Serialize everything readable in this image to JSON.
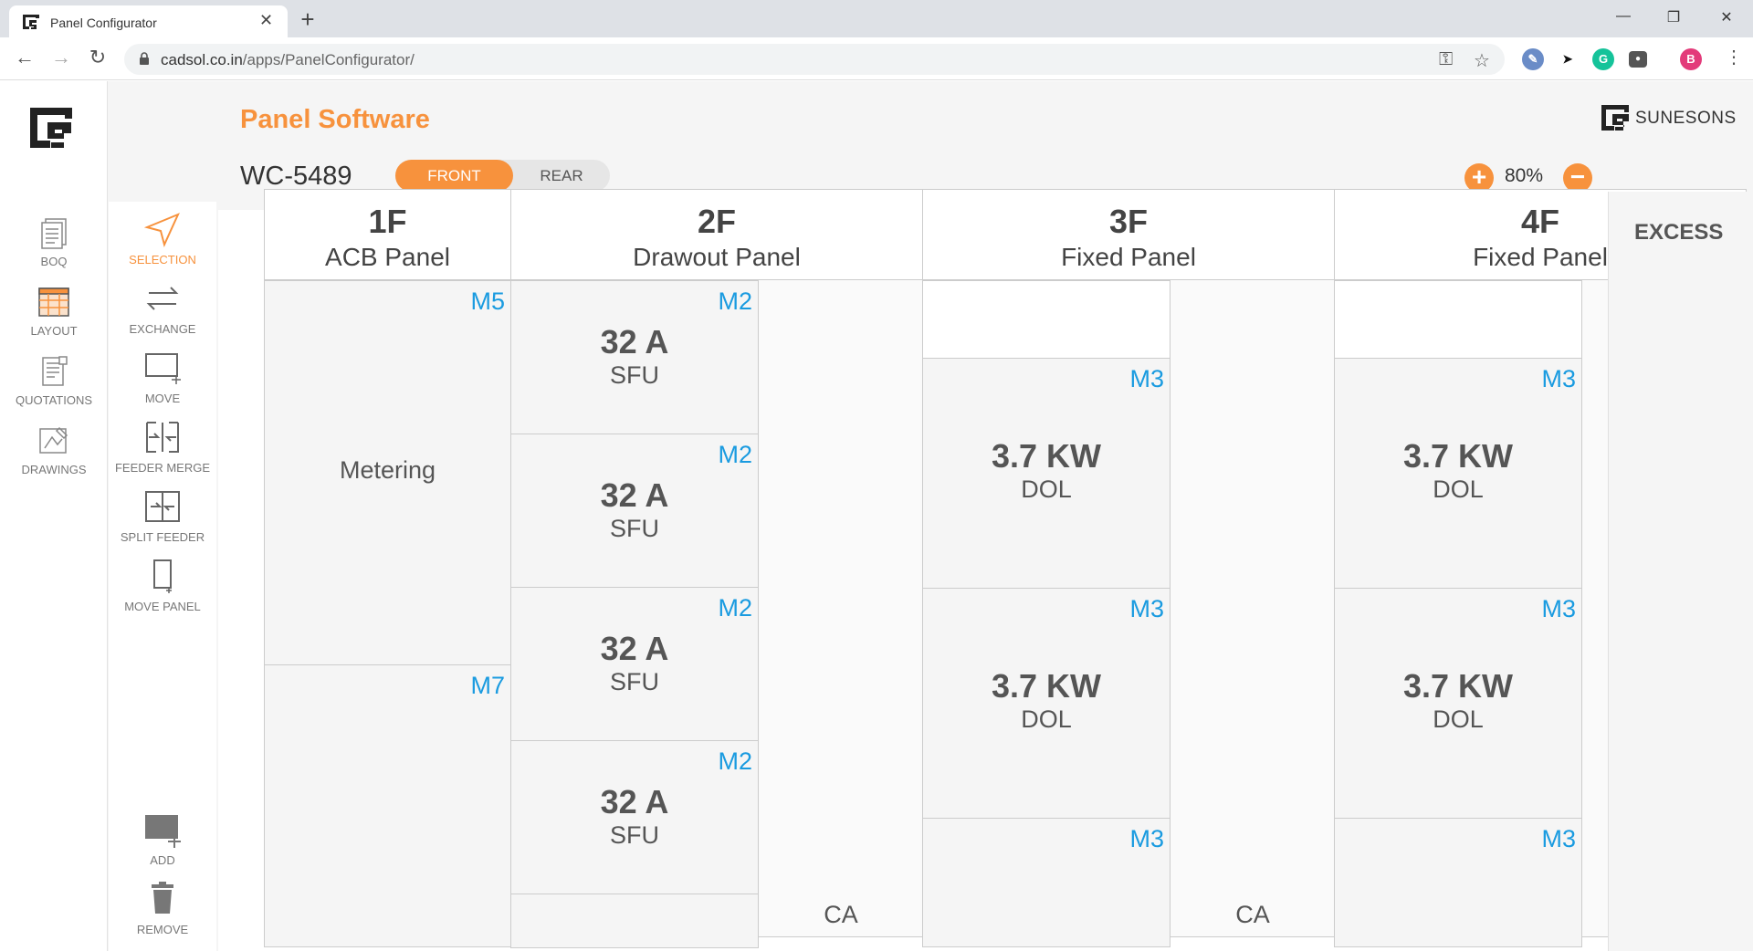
{
  "browser": {
    "tab_title": "Panel Configurator",
    "url_host": "cadsol.co.in",
    "url_path": "/apps/PanelConfigurator/",
    "profile_initial": "B"
  },
  "app": {
    "title": "Panel Software",
    "brand": "SUNESONS",
    "panel_id": "WC-5489",
    "view_toggle": {
      "front": "FRONT",
      "rear": "REAR",
      "selected": "FRONT"
    },
    "zoom": "80%",
    "excess_label": "EXCESS",
    "accent_color": "#f7923d",
    "module_color": "#1a9be0"
  },
  "left_nav": [
    {
      "label": "BOQ",
      "icon": "boq-icon"
    },
    {
      "label": "LAYOUT",
      "icon": "layout-icon"
    },
    {
      "label": "QUOTATIONS",
      "icon": "quotations-icon"
    },
    {
      "label": "DRAWINGS",
      "icon": "drawings-icon"
    }
  ],
  "tools": [
    {
      "label": "SELECTION",
      "icon": "pointer-icon",
      "active": true
    },
    {
      "label": "EXCHANGE",
      "icon": "exchange-icon"
    },
    {
      "label": "MOVE",
      "icon": "move-icon"
    },
    {
      "label": "FEEDER MERGE",
      "icon": "feeder-merge-icon"
    },
    {
      "label": "SPLIT FEEDER",
      "icon": "split-feeder-icon"
    },
    {
      "label": "MOVE PANEL",
      "icon": "move-panel-icon"
    },
    {
      "label": "ADD",
      "icon": "add-icon"
    },
    {
      "label": "REMOVE",
      "icon": "trash-icon"
    }
  ],
  "panels": [
    {
      "num": "1F",
      "name": "ACB Panel",
      "cells": [
        {
          "module": "M5",
          "text": "Metering"
        },
        {
          "module": "M7"
        }
      ]
    },
    {
      "num": "2F",
      "name": "Drawout Panel",
      "cells": [
        {
          "module": "M2",
          "rating": "32 A",
          "type": "SFU"
        },
        {
          "module": "M2",
          "rating": "32 A",
          "type": "SFU"
        },
        {
          "module": "M2",
          "rating": "32 A",
          "type": "SFU"
        },
        {
          "module": "M2",
          "rating": "32 A",
          "type": "SFU"
        }
      ],
      "side": "CA"
    },
    {
      "num": "3F",
      "name": "Fixed Panel",
      "cells": [
        {
          "module": "M3",
          "rating": "3.7 KW",
          "type": "DOL"
        },
        {
          "module": "M3",
          "rating": "3.7 KW",
          "type": "DOL"
        },
        {
          "module": "M3"
        }
      ],
      "side": "CA"
    },
    {
      "num": "4F",
      "name": "Fixed Panel",
      "cells": [
        {
          "module": "M3",
          "rating": "3.7 KW",
          "type": "DOL"
        },
        {
          "module": "M3",
          "rating": "3.7 KW",
          "type": "DOL"
        },
        {
          "module": "M3"
        }
      ]
    }
  ]
}
